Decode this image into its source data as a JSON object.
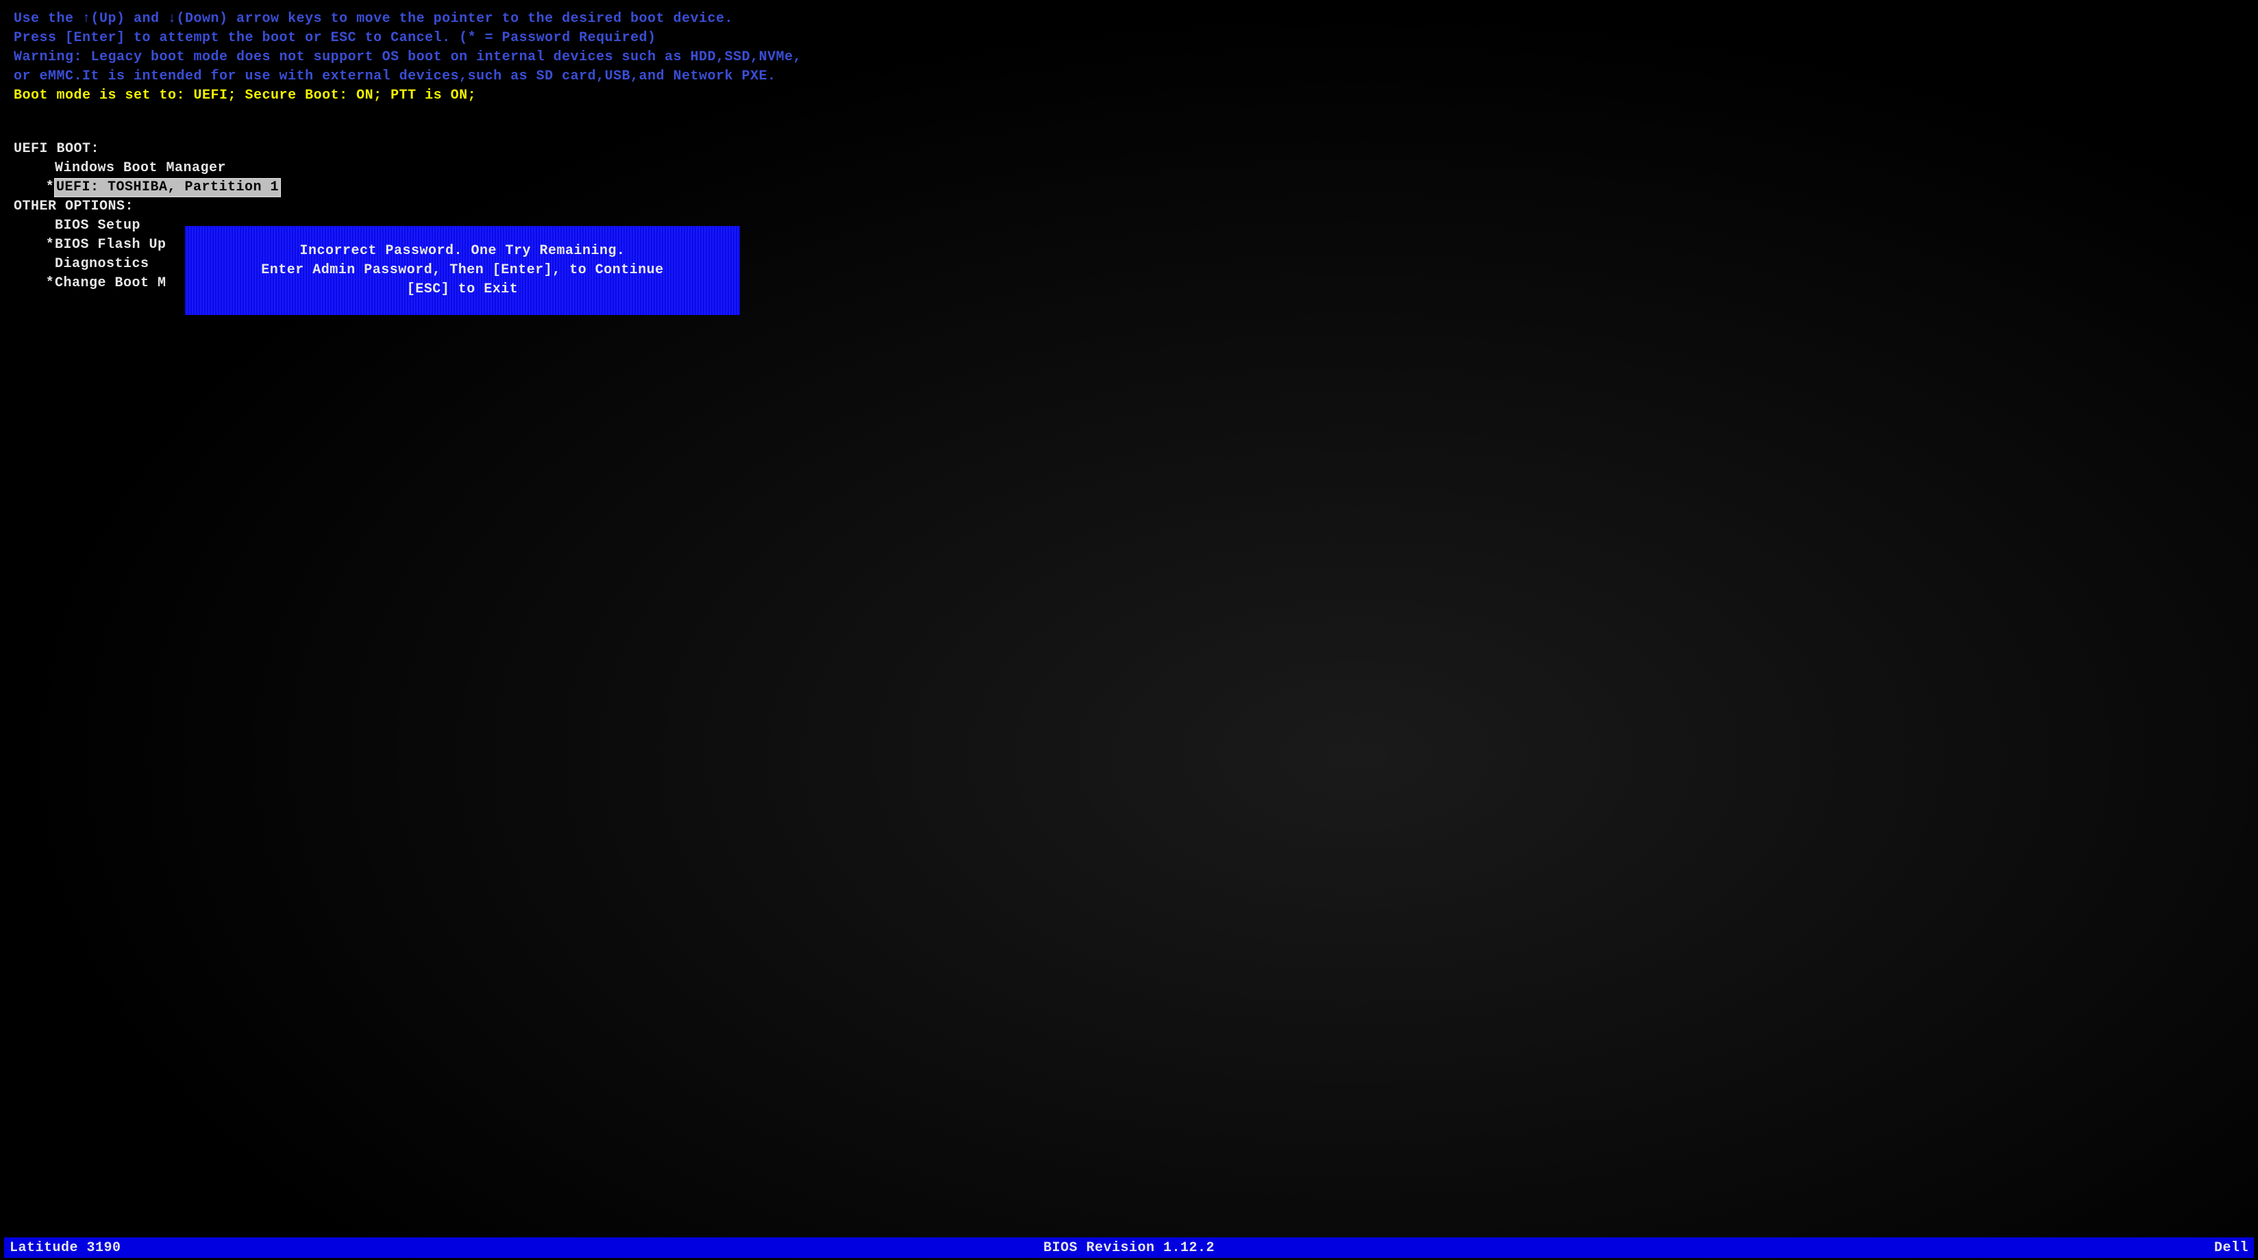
{
  "instructions": {
    "line1": "Use the ↑(Up) and ↓(Down) arrow keys to move the pointer to the desired boot device.",
    "line2": "Press [Enter] to attempt the boot or ESC to Cancel. (* = Password Required)",
    "line3": "Warning: Legacy boot mode does not support OS boot on internal devices such as HDD,SSD,NVMe,",
    "line4": "or eMMC.It is intended for use with external devices,such as SD card,USB,and Network PXE."
  },
  "status_line": "Boot mode is set to: UEFI; Secure Boot: ON; PTT is ON;",
  "sections": {
    "uefi_boot": {
      "heading": "UEFI BOOT:",
      "items": [
        {
          "label": "Windows Boot Manager",
          "password_required": false,
          "selected": false
        },
        {
          "label": "UEFI: TOSHIBA, Partition 1",
          "password_required": true,
          "selected": true
        }
      ]
    },
    "other_options": {
      "heading": "OTHER OPTIONS:",
      "items": [
        {
          "label": "BIOS Setup",
          "password_required": false
        },
        {
          "label": "BIOS Flash Up",
          "password_required": true
        },
        {
          "label": "Diagnostics",
          "password_required": false
        },
        {
          "label": "Change Boot M",
          "password_required": true
        }
      ]
    }
  },
  "dialog": {
    "line1": "Incorrect Password. One Try Remaining.",
    "line2": "Enter Admin Password, Then [Enter], to Continue",
    "line3": "[ESC] to Exit"
  },
  "footer": {
    "model": "Latitude 3190",
    "bios_revision": "BIOS Revision 1.12.2",
    "brand": "Dell"
  },
  "password_marker": "*"
}
